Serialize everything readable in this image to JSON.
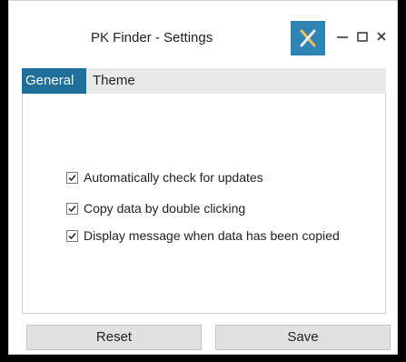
{
  "window": {
    "title": "PK Finder - Settings"
  },
  "title_controls": {
    "tools_icon": "tools-icon",
    "minimize_icon": "minimize-icon",
    "maximize_icon": "maximize-icon",
    "close_icon": "close-icon"
  },
  "tabs": [
    {
      "label": "General",
      "active": true
    },
    {
      "label": "Theme",
      "active": false
    }
  ],
  "options": [
    {
      "label": "Automatically check for updates",
      "checked": true
    },
    {
      "label": "Copy data by double clicking",
      "checked": true
    },
    {
      "label": "Display message when data has been copied",
      "checked": true
    }
  ],
  "footer": {
    "reset_label": "Reset",
    "save_label": "Save"
  },
  "colors": {
    "accent": "#1f6f9a",
    "tool_button": "#2f83b5",
    "tool_icon": "#f2c14e"
  }
}
